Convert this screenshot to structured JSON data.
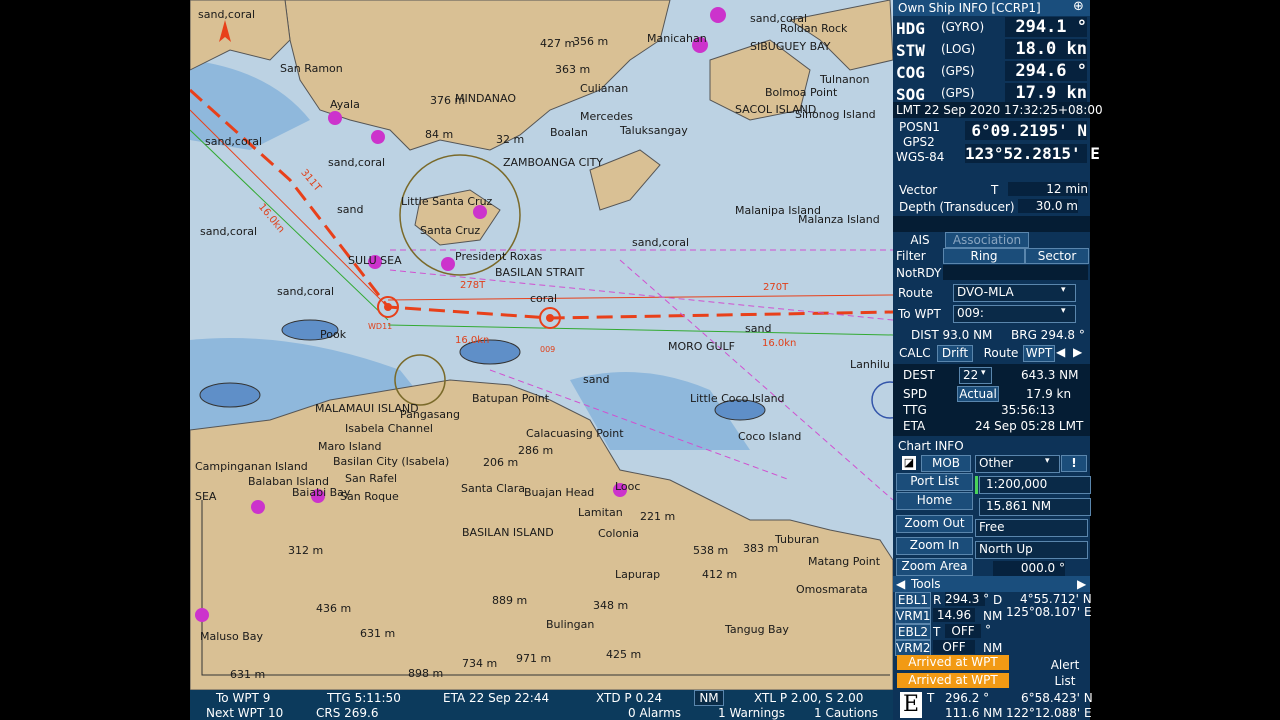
{
  "chart": {
    "labels": [
      "sand,coral",
      "San Ramon",
      "Ayala",
      "sand,coral",
      "sand,coral",
      "sand",
      "sand,coral",
      "SULU SEA",
      "sand,coral",
      "Pook",
      "MINDANAO",
      "427 m",
      "356 m",
      "363 m",
      "376 m",
      "84 m",
      "32 m",
      "Culianan",
      "Boalan",
      "Mercedes",
      "ZAMBOANGA CITY",
      "Taluksangay",
      "Manicahan",
      "SIBUGUEY BAY",
      "sand,coral",
      "Roldan Rock",
      "Tulnanon",
      "Bolmoa Point",
      "SACOL ISLAND",
      "Sinonog Island",
      "Little Santa Cruz",
      "Santa Cruz",
      "President Roxas",
      "BASILAN STRAIT",
      "sand,coral",
      "Malanipa Island",
      "Malanza Island",
      "coral",
      "sand",
      "MORO GULF",
      "Lanhilu",
      "Little Coco Island",
      "Coco Island",
      "sand",
      "MALAMAUI ISLAND",
      "Isabela Channel",
      "Pangasang",
      "Batupan Point",
      "Calacuasing Point",
      "Maro Island",
      "Basilan City (Isabela)",
      "San Rafel",
      "San Roque",
      "Baiabi Bay",
      "206 m",
      "286 m",
      "Santa Clara",
      "Buajan Head",
      "Looc",
      "Lamitan",
      "221 m",
      "Colonia",
      "BASILAN ISLAND",
      "312 m",
      "436 m",
      "631 m",
      "538 m",
      "383 m",
      "Tuburan",
      "412 m",
      "Lapurap",
      "348 m",
      "889 m",
      "971 m",
      "425 m",
      "Bulingan",
      "Tangug Bay",
      "Matang Point",
      "Omosmarata",
      "Maluso Bay",
      "734 m",
      "898 m",
      "631 m",
      "SEA",
      "Balaban Island",
      "Campinganan Island"
    ],
    "route_labels": [
      "311T",
      "16.0kn",
      "278T",
      "270T",
      "16.0kn",
      "16.0kn",
      "WD11",
      "009"
    ],
    "north_arrow": "north-arrow-icon"
  },
  "status": {
    "to_wpt": "To WPT 9",
    "ttg": "TTG 5:11:50",
    "eta": "ETA 22 Sep 22:44",
    "xtd": "XTD P 0.24",
    "nm": "NM",
    "xtl": "XTL P 2.00, S 2.00",
    "next_wpt": "Next WPT 10",
    "crs": "CRS 269.6",
    "alarms": "0 Alarms",
    "warnings": "1 Warnings",
    "cautions": "1 Cautions"
  },
  "panel": {
    "title": "Own Ship INFO [CCRP1]",
    "hdg": {
      "label": "HDG",
      "src": "(GYRO)",
      "value": "294.1 °"
    },
    "stw": {
      "label": "STW",
      "src": "(LOG)",
      "value": "18.0 kn"
    },
    "cog": {
      "label": "COG",
      "src": "(GPS)",
      "value": "294.6 °"
    },
    "sog": {
      "label": "SOG",
      "src": "(GPS)",
      "value": "17.9 kn"
    },
    "lmt": "LMT 22 Sep 2020 17:32:25+08:00",
    "posn1": "POSN1",
    "gps2": "GPS2",
    "datum": "WGS-84",
    "lat": "6°09.2195' N",
    "lon": "123°52.2815' E",
    "vector_label": "Vector",
    "vector_t": "T",
    "vector_value": "12 min",
    "depth_label": "Depth (Transducer)",
    "depth_value": "30.0 m",
    "ais": "AIS",
    "association": "Association",
    "filter": "Filter",
    "ring": "Ring",
    "sector": "Sector",
    "notrdy": "NotRDY",
    "route_label": "Route",
    "route_value": "DVO-MLA",
    "towpt_label": "To WPT",
    "towpt_value": "009:",
    "dist": "DIST 93.0 NM",
    "brg": "BRG 294.8 °",
    "calc": "CALC",
    "drift": "Drift",
    "route_tab": "Route",
    "wpt_tab": "WPT",
    "dest_label": "DEST",
    "dest_value": "22",
    "dest_nm": "643.3 NM",
    "spd_label": "SPD",
    "spd_mode": "Actual",
    "spd_value": "17.9 kn",
    "ttg_label": "TTG",
    "ttg_value": "35:56:13",
    "eta_label": "ETA",
    "eta_value": "24 Sep 05:28 LMT",
    "chart_info": "Chart INFO",
    "mob": "MOB",
    "other": "Other",
    "excl": "!",
    "port_list": "Port List",
    "home": "Home",
    "zoom_out": "Zoom Out",
    "zoom_in": "Zoom In",
    "zoom_area": "Zoom Area",
    "scale": "1:200,000",
    "range": "15.861 NM",
    "mode_free": "Free",
    "north_up": "North Up",
    "rotation": "000.0 °",
    "tools": "Tools",
    "ebl1": "EBL1",
    "ebl1_r": "R",
    "ebl1_val": "294.3 °",
    "ebl1_d": "D",
    "ebl_lat": "4°55.712' N",
    "ebl_lon": "125°08.107' E",
    "vrm1": "VRM1",
    "vrm1_val": "14.96",
    "vrm1_nm": "NM",
    "ebl2": "EBL2",
    "ebl2_t": "T",
    "ebl2_val": "OFF",
    "ebl2_deg": "°",
    "vrm2": "VRM2",
    "vrm2_val": "OFF",
    "vrm2_nm": "NM",
    "arrived1": "Arrived at WPT",
    "arrived2": "Arrived at WPT",
    "alert_list": "Alert List",
    "e_mark": "E",
    "cursor_t": "T",
    "cursor_brg": "296.2 °",
    "cursor_lat": "6°58.423' N",
    "cursor_rng": "111.6 NM",
    "cursor_lon": "122°12.088' E"
  }
}
